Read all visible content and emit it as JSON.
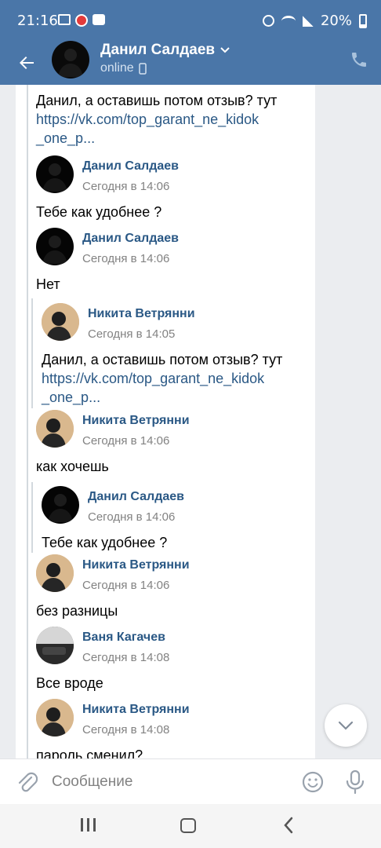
{
  "statusbar": {
    "time": "21:16",
    "battery": "20%"
  },
  "header": {
    "name": "Данил Салдаев",
    "status": "online"
  },
  "messages": [
    {
      "text": "Данил, а оставишь потом отзыв? тут",
      "link1": "https://vk.com/top_garant_ne_kidok",
      "link2": "_one_p..."
    },
    {
      "author": "Данил Салдаев",
      "time": "Сегодня в 14:06",
      "text": "Тебе как удобнее ?"
    },
    {
      "author": "Данил Салдаев",
      "time": "Сегодня в 14:06",
      "text": "Нет"
    },
    {
      "author": "Никита Ветрянни",
      "time": "Сегодня в 14:05",
      "text": "Данил, а оставишь потом отзыв? тут",
      "link1": "https://vk.com/top_garant_ne_kidok",
      "link2": "_one_p..."
    },
    {
      "author": "Никита Ветрянни",
      "time": "Сегодня в 14:06",
      "text": "как хочешь"
    },
    {
      "author": "Данил Салдаев",
      "time": "Сегодня в 14:06",
      "text": "Тебе как удобнее ?"
    },
    {
      "author": "Никита Ветрянни",
      "time": "Сегодня в 14:06",
      "text": "без разницы"
    },
    {
      "author": "Ваня Кагачев",
      "time": "Сегодня в 14:08",
      "text": "Все вроде"
    },
    {
      "author": "Никита Ветрянни",
      "time": "Сегодня в 14:08",
      "text": "пароль сменил?"
    }
  ],
  "composer": {
    "placeholder": "Сообщение"
  },
  "icons": {
    "back": "arrow-left-icon",
    "dropdown": "chevron-down-icon",
    "mobile": "mobile-phone-icon",
    "call": "phone-icon",
    "attach": "paperclip-icon",
    "emoji": "smile-icon",
    "mic": "microphone-icon",
    "scroll": "chevron-down-icon"
  },
  "colors": {
    "accent": "#4a76a8",
    "link": "#2a5885",
    "meta": "#828282"
  }
}
